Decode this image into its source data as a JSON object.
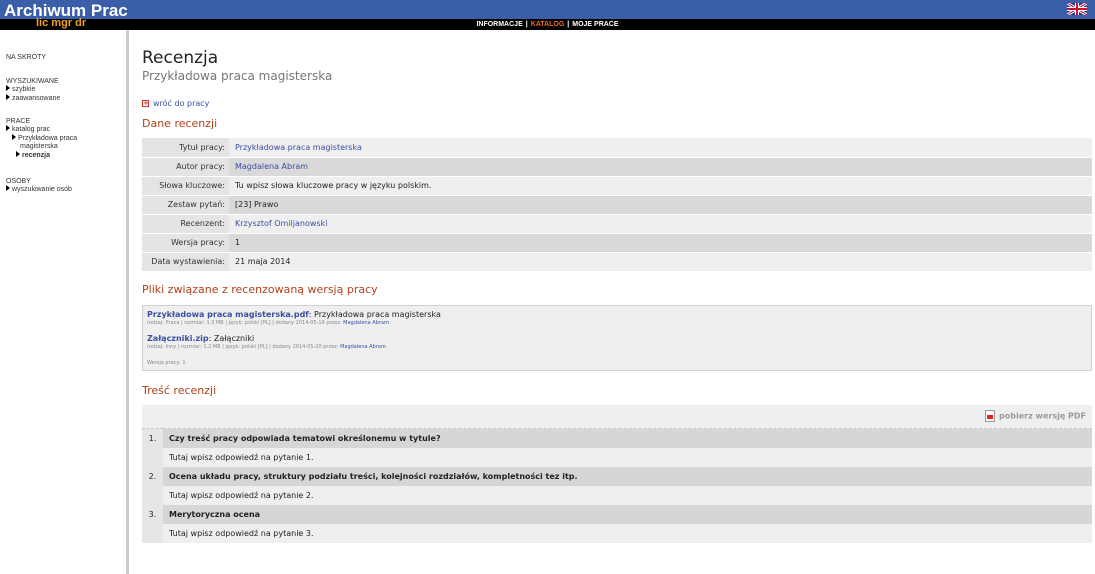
{
  "header": {
    "logo_title": "Archiwum Prac",
    "logo_sub": "lic mgr dr",
    "nav": [
      "INFORMACJE",
      "KATALOG",
      "MOJE PRACE"
    ],
    "nav_separator": "|"
  },
  "sidebar": {
    "shortcuts": "NA SKRÓTY",
    "search_head": "WYSZUKIWANE",
    "search_items": [
      "szybkie",
      "zaawansowane"
    ],
    "works_head": "PRACE",
    "works_catalog": "katalog prac",
    "works_example_line1": "Przykładowa praca",
    "works_example_line2": "magisterska",
    "works_review": "recenzja",
    "people_head": "OSOBY",
    "people_search": "wyszukiwanie osób"
  },
  "main": {
    "title": "Recenzja",
    "subtitle": "Przykładowa praca magisterska",
    "back_link": "wróć do pracy",
    "section_review_data": "Dane recenzji",
    "info_rows": [
      {
        "label": "Tytuł pracy:",
        "value": "Przykładowa praca magisterska"
      },
      {
        "label": "Autor pracy:",
        "value": "Magdalena Abram"
      },
      {
        "label": "Słowa kluczowe:",
        "value": "Tu wpisz słowa kluczowe pracy w języku polskim."
      },
      {
        "label": "Zestaw pytań:",
        "value": "[23] Prawo"
      },
      {
        "label": "Recenzent:",
        "value": "Krzysztof Omiljanowski"
      },
      {
        "label": "Wersja pracy:",
        "value": "1"
      },
      {
        "label": "Data wystawienia:",
        "value": "21 maja 2014"
      }
    ],
    "section_files": "Pliki związane z recenzowaną wersją pracy",
    "files": [
      {
        "name": "Przykładowa praca magisterska.pdf",
        "desc": ": Przykładowa praca magisterska",
        "meta": "rodzaj: Praca | rozmiar: 1.3 MB | język: polski [PL] | dodany 2014-05-19 przez: ",
        "author": "Magdalena Abram"
      },
      {
        "name": "Załączniki.zip",
        "desc": ": Załączniki",
        "meta": "rodzaj: Inny | rozmiar: 1.2 MB | język: polski [PL] | dodany 2014-05-20 przez: ",
        "author": "Magdalena Abram"
      }
    ],
    "files_version": "Wersja pracy: 1",
    "section_content": "Treść recenzji",
    "pdf_label": "pobierz wersję PDF",
    "questions": [
      {
        "num": "1.",
        "q": "Czy treść pracy odpowiada tematowi określonemu w tytule?",
        "a": "Tutaj wpisz odpowiedź na pytanie 1."
      },
      {
        "num": "2.",
        "q": "Ocena układu pracy, struktury podziału treści, kolejności rozdziałów, kompletności tez itp.",
        "a": "Tutaj wpisz odpowiedź na pytanie 2."
      },
      {
        "num": "3.",
        "q": "Merytoryczna ocena",
        "a": "Tutaj wpisz odpowiedź na pytanie 3."
      }
    ]
  },
  "colors": {
    "header_blue": "#3a5ea8",
    "accent_orange": "#f06a2a",
    "section_red": "#b0401a",
    "link_blue": "#3a50a0"
  }
}
